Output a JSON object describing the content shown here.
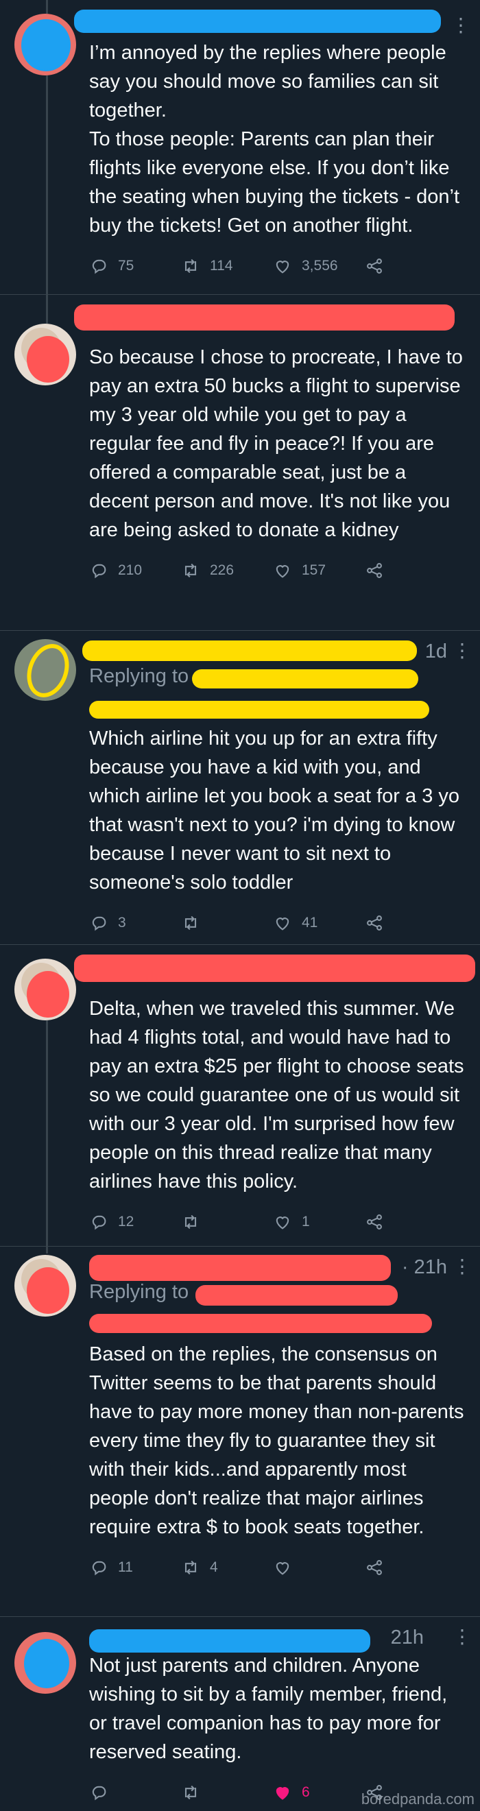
{
  "tweets": [
    {
      "time": "",
      "reply_to": null,
      "text": "I’m annoyed by the replies where people say you should move so families can sit together.\nTo those people: Parents can plan their flights like everyone else. If you don’t like the seating when buying the tickets - don’t buy the tickets! Get on another flight.",
      "replies": "75",
      "retweets": "114",
      "likes": "3,556"
    },
    {
      "time": "",
      "reply_to": null,
      "text": "So because I chose to procreate, I have to pay an extra 50 bucks a flight to supervise my 3 year old while you get to pay a regular fee and fly in peace?! If you are offered a comparable seat, just be a decent person and move. It's not like you are being asked to donate a kidney",
      "replies": "210",
      "retweets": "226",
      "likes": "157"
    },
    {
      "time": "1d",
      "reply_to": {
        "prefix": "Replying to"
      },
      "text": "Which airline hit you up for an extra fifty because you have a kid with you, and which airline let you book a seat for a 3 yo that wasn't next to you? i'm dying to know because I never want to sit next to someone's solo toddler",
      "replies": "3",
      "retweets": "",
      "likes": "41"
    },
    {
      "time": "",
      "reply_to": null,
      "text": "Delta, when we traveled this summer. We had 4 flights total, and would have had to pay an extra $25 per flight to choose seats so we could guarantee one of us would sit with our 3 year old. I'm surprised how few people on this thread realize that many airlines have this policy.",
      "replies": "12",
      "retweets": "",
      "likes": "1"
    },
    {
      "time": "· 21h",
      "reply_to": {
        "prefix": "Replying to"
      },
      "text": "Based on the replies, the consensus on Twitter seems to be that parents should have to pay more money than non-parents every time they fly to guarantee they sit with their kids...and apparently most people don't realize that major airlines require extra $ to book seats together.",
      "replies": "11",
      "retweets": "4",
      "likes": ""
    },
    {
      "time": "21h",
      "reply_to": null,
      "text": "Not just parents and children. Anyone wishing to sit by a family member, friend, or travel companion has to pay more for reserved seating.",
      "replies": "",
      "retweets": "",
      "likes": "6"
    }
  ],
  "watermark": "boredpanda.com",
  "colors": {
    "background": "#15202b",
    "text": "#f7f9f9",
    "muted": "#8b98a5",
    "like_active": "#f91880",
    "redact_blue": "#1da1f2",
    "redact_red": "#ff5555",
    "redact_yellow": "#ffdd00"
  },
  "icons": [
    "more-icon",
    "reply-icon",
    "retweet-icon",
    "like-icon",
    "share-icon"
  ]
}
